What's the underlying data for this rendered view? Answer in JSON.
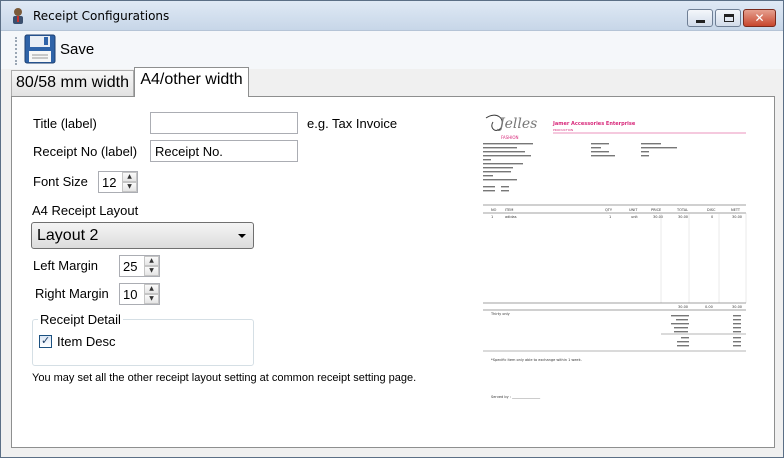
{
  "window": {
    "title": "Receipt Configurations",
    "controls": {
      "minimize": "_",
      "maximize": "□",
      "close": "✕"
    }
  },
  "toolbar": {
    "save_label": "Save",
    "save_icon": "floppy-disk-icon"
  },
  "tabs": [
    {
      "label": "80/58 mm width",
      "active": false
    },
    {
      "label": "A4/other width",
      "active": true
    }
  ],
  "form": {
    "title_label": "Title (label)",
    "title_value": "",
    "title_hint": "e.g. Tax Invoice",
    "receipt_no_label": "Receipt No (label)",
    "receipt_no_value": "Receipt No.",
    "font_size_label": "Font Size",
    "font_size_value": "12",
    "layout_label": "A4 Receipt Layout",
    "layout_value": "Layout 2",
    "left_margin_label": "Left Margin",
    "left_margin_value": "25",
    "right_margin_label": "Right Margin",
    "right_margin_value": "10",
    "receipt_detail_group": "Receipt Detail",
    "item_desc_label": "Item Desc",
    "item_desc_checked": true,
    "note": "You may set all the other receipt layout setting at common receipt setting page."
  },
  "preview": {
    "company_name": "Jamer Accessories Enterprise",
    "company_sub": "PRODUCTION",
    "accent_color": "#d8287a",
    "table_headers": [
      "NO",
      "ITEM",
      "QTY",
      "UNIT",
      "PRICE",
      "TOTAL",
      "DISC",
      "NETT"
    ],
    "row": [
      "1",
      "adidas",
      "1",
      "unit",
      "30.00",
      "30.00",
      "0",
      "30.00"
    ],
    "totals_row": [
      "30.00",
      "0.00",
      "30.00"
    ],
    "amount_words": "Thirty only",
    "footer_note": "*Specific item only able to exchange within 1 week.",
    "served_by": "Served by : ________________"
  }
}
